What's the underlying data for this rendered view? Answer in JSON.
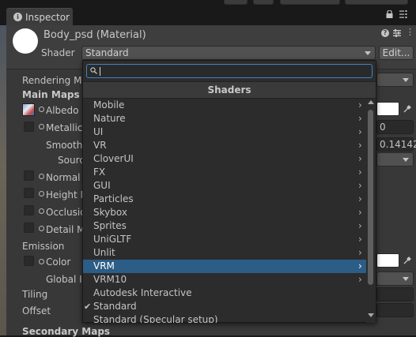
{
  "tab": {
    "title": "Inspector"
  },
  "header": {
    "title": "Body_psd (Material)",
    "shader_label": "Shader",
    "shader_value": "Standard",
    "edit_label": "Edit..."
  },
  "properties": {
    "rendering_mode": "Rendering Mo",
    "main_maps": "Main Maps",
    "albedo": "Albedo",
    "metallic": "Metallic",
    "metallic_value": "0",
    "smoothness": "Smoothn",
    "smoothness_value": "0.14142",
    "source": "Sourc",
    "normal_map": "Normal I",
    "height_map": "Height M",
    "occlusion": "Occlusio",
    "detail_mask": "Detail M",
    "emission": "Emission",
    "color": "Color",
    "global_illumination": "Global Il",
    "tiling": "Tiling",
    "offset": "Offset",
    "secondary_maps": "Secondary Maps"
  },
  "dropdown": {
    "search_value": "",
    "header": "Shaders",
    "items": [
      {
        "label": "Mobile",
        "submenu": true,
        "highlighted": false,
        "checked": false
      },
      {
        "label": "Nature",
        "submenu": true,
        "highlighted": false,
        "checked": false
      },
      {
        "label": "UI",
        "submenu": true,
        "highlighted": false,
        "checked": false
      },
      {
        "label": "VR",
        "submenu": true,
        "highlighted": false,
        "checked": false
      },
      {
        "label": "CloverUI",
        "submenu": true,
        "highlighted": false,
        "checked": false
      },
      {
        "label": "FX",
        "submenu": true,
        "highlighted": false,
        "checked": false
      },
      {
        "label": "GUI",
        "submenu": true,
        "highlighted": false,
        "checked": false
      },
      {
        "label": "Particles",
        "submenu": true,
        "highlighted": false,
        "checked": false
      },
      {
        "label": "Skybox",
        "submenu": true,
        "highlighted": false,
        "checked": false
      },
      {
        "label": "Sprites",
        "submenu": true,
        "highlighted": false,
        "checked": false
      },
      {
        "label": "UniGLTF",
        "submenu": true,
        "highlighted": false,
        "checked": false
      },
      {
        "label": "Unlit",
        "submenu": true,
        "highlighted": false,
        "checked": false
      },
      {
        "label": "VRM",
        "submenu": true,
        "highlighted": true,
        "checked": false
      },
      {
        "label": "VRM10",
        "submenu": true,
        "highlighted": false,
        "checked": false
      },
      {
        "label": "Autodesk Interactive",
        "submenu": false,
        "highlighted": false,
        "checked": false
      },
      {
        "label": "Standard",
        "submenu": false,
        "highlighted": false,
        "checked": true
      },
      {
        "label": "Standard (Specular setup)",
        "submenu": false,
        "highlighted": false,
        "checked": false
      }
    ]
  },
  "colors": {
    "highlight": "#2c5d87",
    "panel": "#383838",
    "search_focus": "#3d85c6"
  }
}
